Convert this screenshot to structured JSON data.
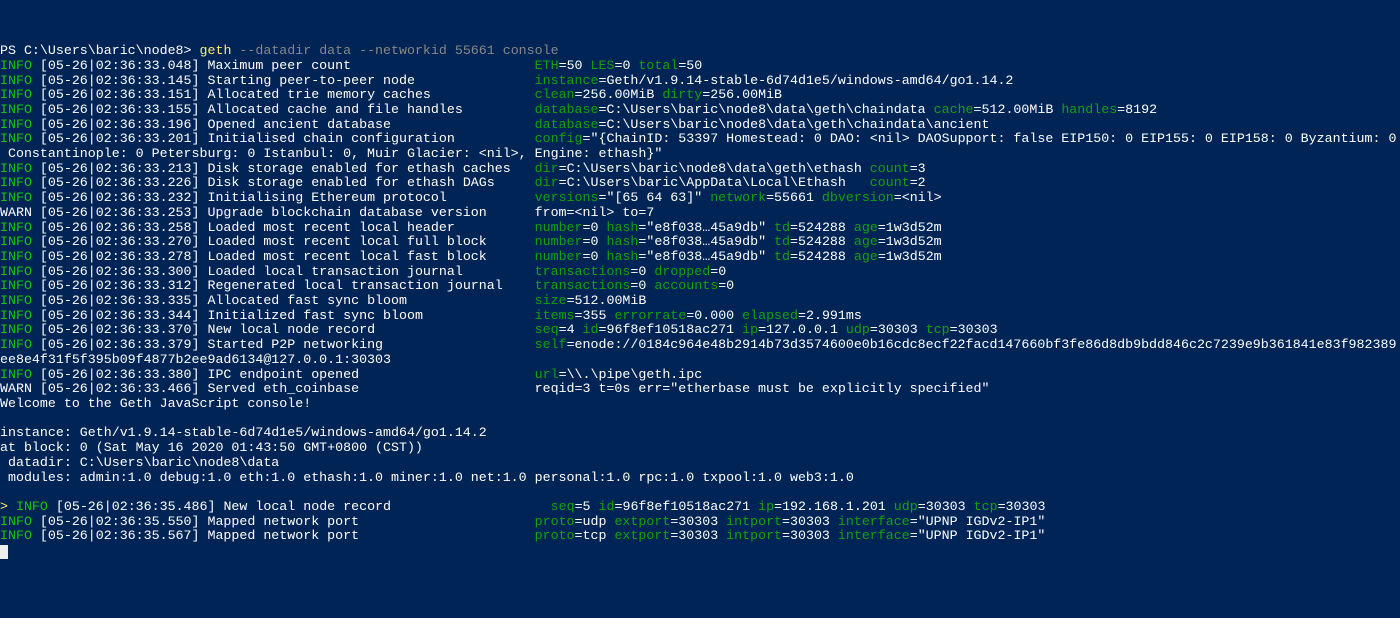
{
  "prompt_prefix": "PS C:\\Users\\baric\\node8> ",
  "cmd_main": "geth",
  "cmd_args": " --datadir data --networkid 55661 console",
  "lines": [
    [
      [
        "grn",
        "INFO "
      ],
      [
        "w",
        "[05-26|02:36:33.048] Maximum peer count                       "
      ],
      [
        "dgrn",
        "ETH"
      ],
      [
        "w",
        "=50 "
      ],
      [
        "dgrn",
        "LES"
      ],
      [
        "w",
        "=0 "
      ],
      [
        "dgrn",
        "total"
      ],
      [
        "w",
        "=50"
      ]
    ],
    [
      [
        "grn",
        "INFO "
      ],
      [
        "w",
        "[05-26|02:36:33.145] Starting peer-to-peer node               "
      ],
      [
        "dgrn",
        "instance"
      ],
      [
        "w",
        "=Geth/v1.9.14-stable-6d74d1e5/windows-amd64/go1.14.2"
      ]
    ],
    [
      [
        "grn",
        "INFO "
      ],
      [
        "w",
        "[05-26|02:36:33.151] Allocated trie memory caches             "
      ],
      [
        "dgrn",
        "clean"
      ],
      [
        "w",
        "=256.00MiB "
      ],
      [
        "dgrn",
        "dirty"
      ],
      [
        "w",
        "=256.00MiB"
      ]
    ],
    [
      [
        "grn",
        "INFO "
      ],
      [
        "w",
        "[05-26|02:36:33.155] Allocated cache and file handles         "
      ],
      [
        "dgrn",
        "database"
      ],
      [
        "w",
        "=C:\\Users\\baric\\node8\\data\\geth\\chaindata "
      ],
      [
        "dgrn",
        "cache"
      ],
      [
        "w",
        "=512.00MiB "
      ],
      [
        "dgrn",
        "handles"
      ],
      [
        "w",
        "=8192"
      ]
    ],
    [
      [
        "grn",
        "INFO "
      ],
      [
        "w",
        "[05-26|02:36:33.196] Opened ancient database                  "
      ],
      [
        "dgrn",
        "database"
      ],
      [
        "w",
        "=C:\\Users\\baric\\node8\\data\\geth\\chaindata\\ancient"
      ]
    ],
    [
      [
        "grn",
        "INFO "
      ],
      [
        "w",
        "[05-26|02:36:33.201] Initialised chain configuration          "
      ],
      [
        "dgrn",
        "config"
      ],
      [
        "w",
        "=\"{ChainID: 53397 Homestead: 0 DAO: <nil> DAOSupport: false EIP150: 0 EIP155: 0 EIP158: 0 Byzantium: 0"
      ]
    ],
    [
      [
        "w",
        " Constantinople: 0 Petersburg: 0 Istanbul: 0, Muir Glacier: <nil>, Engine: ethash}\""
      ]
    ],
    [
      [
        "grn",
        "INFO "
      ],
      [
        "w",
        "[05-26|02:36:33.213] Disk storage enabled for ethash caches   "
      ],
      [
        "dgrn",
        "dir"
      ],
      [
        "w",
        "=C:\\Users\\baric\\node8\\data\\geth\\ethash "
      ],
      [
        "dgrn",
        "count"
      ],
      [
        "w",
        "=3"
      ]
    ],
    [
      [
        "grn",
        "INFO "
      ],
      [
        "w",
        "[05-26|02:36:33.226] Disk storage enabled for ethash DAGs     "
      ],
      [
        "dgrn",
        "dir"
      ],
      [
        "w",
        "=C:\\Users\\baric\\AppData\\Local\\Ethash   "
      ],
      [
        "dgrn",
        "count"
      ],
      [
        "w",
        "=2"
      ]
    ],
    [
      [
        "grn",
        "INFO "
      ],
      [
        "w",
        "[05-26|02:36:33.232] Initialising Ethereum protocol           "
      ],
      [
        "dgrn",
        "versions"
      ],
      [
        "w",
        "=\"[65 64 63]\" "
      ],
      [
        "dgrn",
        "network"
      ],
      [
        "w",
        "=55661 "
      ],
      [
        "dgrn",
        "dbversion"
      ],
      [
        "w",
        "=<nil>"
      ]
    ],
    [
      [
        "w",
        "WARN [05-26|02:36:33.253] Upgrade blockchain database version      from=<nil> to=7"
      ]
    ],
    [
      [
        "grn",
        "INFO "
      ],
      [
        "w",
        "[05-26|02:36:33.258] Loaded most recent local header          "
      ],
      [
        "dgrn",
        "number"
      ],
      [
        "w",
        "=0 "
      ],
      [
        "dgrn",
        "hash"
      ],
      [
        "w",
        "=\"e8f038…45a9db\" "
      ],
      [
        "dgrn",
        "td"
      ],
      [
        "w",
        "=524288 "
      ],
      [
        "dgrn",
        "age"
      ],
      [
        "w",
        "=1w3d52m"
      ]
    ],
    [
      [
        "grn",
        "INFO "
      ],
      [
        "w",
        "[05-26|02:36:33.270] Loaded most recent local full block      "
      ],
      [
        "dgrn",
        "number"
      ],
      [
        "w",
        "=0 "
      ],
      [
        "dgrn",
        "hash"
      ],
      [
        "w",
        "=\"e8f038…45a9db\" "
      ],
      [
        "dgrn",
        "td"
      ],
      [
        "w",
        "=524288 "
      ],
      [
        "dgrn",
        "age"
      ],
      [
        "w",
        "=1w3d52m"
      ]
    ],
    [
      [
        "grn",
        "INFO "
      ],
      [
        "w",
        "[05-26|02:36:33.278] Loaded most recent local fast block      "
      ],
      [
        "dgrn",
        "number"
      ],
      [
        "w",
        "=0 "
      ],
      [
        "dgrn",
        "hash"
      ],
      [
        "w",
        "=\"e8f038…45a9db\" "
      ],
      [
        "dgrn",
        "td"
      ],
      [
        "w",
        "=524288 "
      ],
      [
        "dgrn",
        "age"
      ],
      [
        "w",
        "=1w3d52m"
      ]
    ],
    [
      [
        "grn",
        "INFO "
      ],
      [
        "w",
        "[05-26|02:36:33.300] Loaded local transaction journal         "
      ],
      [
        "dgrn",
        "transactions"
      ],
      [
        "w",
        "=0 "
      ],
      [
        "dgrn",
        "dropped"
      ],
      [
        "w",
        "=0"
      ]
    ],
    [
      [
        "grn",
        "INFO "
      ],
      [
        "w",
        "[05-26|02:36:33.312] Regenerated local transaction journal    "
      ],
      [
        "dgrn",
        "transactions"
      ],
      [
        "w",
        "=0 "
      ],
      [
        "dgrn",
        "accounts"
      ],
      [
        "w",
        "=0"
      ]
    ],
    [
      [
        "grn",
        "INFO "
      ],
      [
        "w",
        "[05-26|02:36:33.335] Allocated fast sync bloom                "
      ],
      [
        "dgrn",
        "size"
      ],
      [
        "w",
        "=512.00MiB"
      ]
    ],
    [
      [
        "grn",
        "INFO "
      ],
      [
        "w",
        "[05-26|02:36:33.344] Initialized fast sync bloom              "
      ],
      [
        "dgrn",
        "items"
      ],
      [
        "w",
        "=355 "
      ],
      [
        "dgrn",
        "errorrate"
      ],
      [
        "w",
        "=0.000 "
      ],
      [
        "dgrn",
        "elapsed"
      ],
      [
        "w",
        "=2.991ms"
      ]
    ],
    [
      [
        "grn",
        "INFO "
      ],
      [
        "w",
        "[05-26|02:36:33.370] New local node record                    "
      ],
      [
        "dgrn",
        "seq"
      ],
      [
        "w",
        "=4 "
      ],
      [
        "dgrn",
        "id"
      ],
      [
        "w",
        "=96f8ef10518ac271 "
      ],
      [
        "dgrn",
        "ip"
      ],
      [
        "w",
        "=127.0.0.1 "
      ],
      [
        "dgrn",
        "udp"
      ],
      [
        "w",
        "=30303 "
      ],
      [
        "dgrn",
        "tcp"
      ],
      [
        "w",
        "=30303"
      ]
    ],
    [
      [
        "grn",
        "INFO "
      ],
      [
        "w",
        "[05-26|02:36:33.379] Started P2P networking                   "
      ],
      [
        "dgrn",
        "self"
      ],
      [
        "w",
        "=enode://0184c964e48b2914b73d3574600e0b16cdc8ecf22facd147660bf3fe86d8db9bdd846c2c7239e9b361841e83f982389"
      ]
    ],
    [
      [
        "w",
        "ee8e4f31f5f395b09f4877b2ee9ad6134@127.0.0.1:30303"
      ]
    ],
    [
      [
        "grn",
        "INFO "
      ],
      [
        "w",
        "[05-26|02:36:33.380] IPC endpoint opened                      "
      ],
      [
        "dgrn",
        "url"
      ],
      [
        "w",
        "=\\\\.\\pipe\\geth.ipc"
      ]
    ],
    [
      [
        "w",
        "WARN [05-26|02:36:33.466] Served eth_coinbase                      reqid=3 t=0s err=\"etherbase must be explicitly specified\""
      ]
    ],
    [
      [
        "w",
        "Welcome to the Geth JavaScript console!"
      ]
    ],
    [
      [
        "w",
        " "
      ]
    ],
    [
      [
        "w",
        "instance: Geth/v1.9.14-stable-6d74d1e5/windows-amd64/go1.14.2"
      ]
    ],
    [
      [
        "w",
        "at block: 0 (Sat May 16 2020 01:43:50 GMT+0800 (CST))"
      ]
    ],
    [
      [
        "w",
        " datadir: C:\\Users\\baric\\node8\\data"
      ]
    ],
    [
      [
        "w",
        " modules: admin:1.0 debug:1.0 eth:1.0 ethash:1.0 miner:1.0 net:1.0 personal:1.0 rpc:1.0 txpool:1.0 web3:1.0"
      ]
    ],
    [
      [
        "w",
        " "
      ]
    ],
    [
      [
        "y",
        "> "
      ],
      [
        "grn",
        "INFO "
      ],
      [
        "w",
        "[05-26|02:36:35.486] New local node record                    "
      ],
      [
        "dgrn",
        "seq"
      ],
      [
        "w",
        "=5 "
      ],
      [
        "dgrn",
        "id"
      ],
      [
        "w",
        "=96f8ef10518ac271 "
      ],
      [
        "dgrn",
        "ip"
      ],
      [
        "w",
        "=192.168.1.201 "
      ],
      [
        "dgrn",
        "udp"
      ],
      [
        "w",
        "=30303 "
      ],
      [
        "dgrn",
        "tcp"
      ],
      [
        "w",
        "=30303"
      ]
    ],
    [
      [
        "grn",
        "INFO "
      ],
      [
        "w",
        "[05-26|02:36:35.550] Mapped network port                      "
      ],
      [
        "dgrn",
        "proto"
      ],
      [
        "w",
        "=udp "
      ],
      [
        "dgrn",
        "extport"
      ],
      [
        "w",
        "=30303 "
      ],
      [
        "dgrn",
        "intport"
      ],
      [
        "w",
        "=30303 "
      ],
      [
        "dgrn",
        "interface"
      ],
      [
        "w",
        "=\"UPNP IGDv2-IP1\""
      ]
    ],
    [
      [
        "grn",
        "INFO "
      ],
      [
        "w",
        "[05-26|02:36:35.567] Mapped network port                      "
      ],
      [
        "dgrn",
        "proto"
      ],
      [
        "w",
        "=tcp "
      ],
      [
        "dgrn",
        "extport"
      ],
      [
        "w",
        "=30303 "
      ],
      [
        "dgrn",
        "intport"
      ],
      [
        "w",
        "=30303 "
      ],
      [
        "dgrn",
        "interface"
      ],
      [
        "w",
        "=\"UPNP IGDv2-IP1\""
      ]
    ]
  ]
}
